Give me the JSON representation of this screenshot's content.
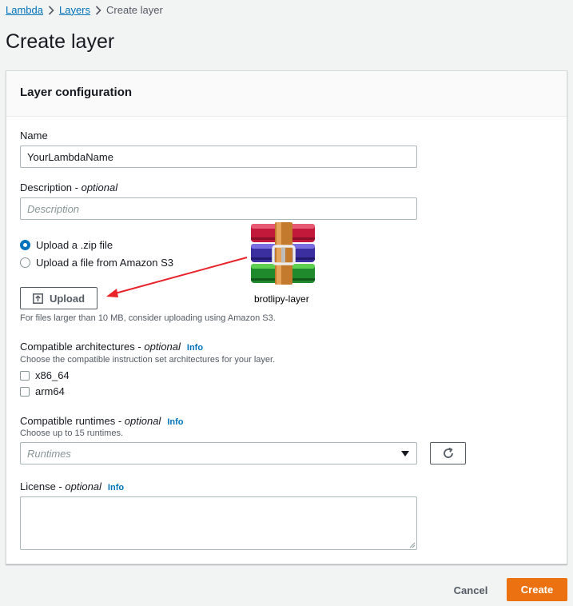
{
  "breadcrumb": {
    "items": [
      "Lambda",
      "Layers"
    ],
    "current": "Create layer"
  },
  "page_title": "Create layer",
  "panel": {
    "title": "Layer configuration",
    "name": {
      "label": "Name",
      "value": "YourLambdaName"
    },
    "description": {
      "label": "Description",
      "optional": "optional",
      "placeholder": "Description"
    },
    "upload_source": {
      "options": [
        "Upload a .zip file",
        "Upload a file from Amazon S3"
      ],
      "selected_index": 0
    },
    "upload_button": "Upload",
    "upload_hint": "For files larger than 10 MB, consider uploading using Amazon S3.",
    "architectures": {
      "label": "Compatible architectures",
      "optional": "optional",
      "info": "Info",
      "hint": "Choose the compatible instruction set architectures for your layer.",
      "options": [
        {
          "label": "x86_64",
          "checked": false
        },
        {
          "label": "arm64",
          "checked": false
        }
      ]
    },
    "runtimes": {
      "label": "Compatible runtimes",
      "optional": "optional",
      "info": "Info",
      "hint": "Choose up to 15 runtimes.",
      "placeholder": "Runtimes"
    },
    "license": {
      "label": "License",
      "optional": "optional",
      "info": "Info",
      "value": ""
    }
  },
  "overlay": {
    "file_icon": "winrar-archive-icon",
    "file_name": "brotlipy-layer",
    "arrow_color": "#e8232a"
  },
  "footer": {
    "cancel": "Cancel",
    "create": "Create"
  },
  "colors": {
    "accent": "#0073bb",
    "primary_button": "#ec7211",
    "link": "#0073bb"
  }
}
